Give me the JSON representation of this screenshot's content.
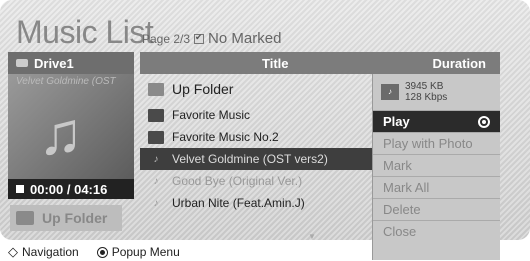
{
  "header": {
    "title": "Music List",
    "page_info": "Page 2/3",
    "no_marked": "No Marked"
  },
  "drive": {
    "label": "Drive1",
    "subtitle": "Velvet Goldmine (OST",
    "time": "00:00 / 04:16",
    "up_folder": "Up Folder"
  },
  "list": {
    "col_title": "Title",
    "col_duration": "Duration",
    "rows": [
      {
        "label": "Up Folder",
        "kind": "folder"
      },
      {
        "label": "Favorite Music",
        "kind": "folder"
      },
      {
        "label": "Favorite Music No.2",
        "kind": "folder"
      },
      {
        "label": "Velvet Goldmine (OST vers2)",
        "kind": "music",
        "selected": true
      },
      {
        "label": "Good Bye (Original Ver.)",
        "kind": "music"
      },
      {
        "label": "Urban Nite (Feat.Amin.J)",
        "kind": "music"
      }
    ]
  },
  "popup": {
    "size": "3945 KB",
    "bitrate": "128 Kbps",
    "items": [
      "Play",
      "Play with Photo",
      "Mark",
      "Mark All",
      "Delete",
      "Close"
    ]
  },
  "footer": {
    "navigation": "Navigation",
    "popup_menu": "Popup Menu"
  }
}
